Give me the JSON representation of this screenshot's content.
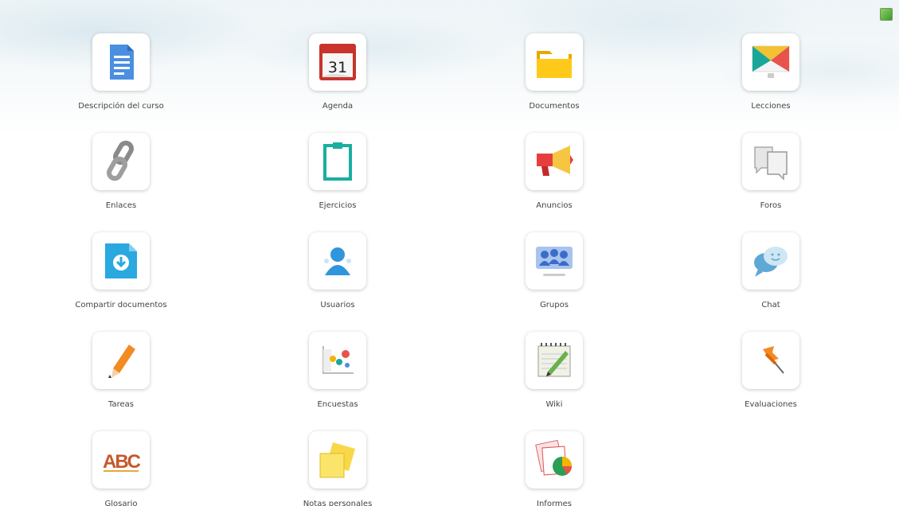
{
  "tools": [
    {
      "label": "Descripción del curso",
      "icon": "document-icon"
    },
    {
      "label": "Agenda",
      "icon": "calendar-icon",
      "day": "31"
    },
    {
      "label": "Documentos",
      "icon": "folder-icon"
    },
    {
      "label": "Lecciones",
      "icon": "monitor-icon"
    },
    {
      "label": "Enlaces",
      "icon": "chain-link-icon"
    },
    {
      "label": "Ejercicios",
      "icon": "clipboard-icon"
    },
    {
      "label": "Anuncios",
      "icon": "megaphone-icon"
    },
    {
      "label": "Foros",
      "icon": "speech-bubbles-icon"
    },
    {
      "label": "Compartir documentos",
      "icon": "download-document-icon"
    },
    {
      "label": "Usuarios",
      "icon": "user-icon"
    },
    {
      "label": "Grupos",
      "icon": "group-icon"
    },
    {
      "label": "Chat",
      "icon": "chat-bubbles-icon"
    },
    {
      "label": "Tareas",
      "icon": "pencil-icon"
    },
    {
      "label": "Encuestas",
      "icon": "survey-chart-icon"
    },
    {
      "label": "Wiki",
      "icon": "notepad-pencil-icon"
    },
    {
      "label": "Evaluaciones",
      "icon": "pushpin-icon"
    },
    {
      "label": "Glosario",
      "icon": "abc-icon",
      "abc_text": "ABC"
    },
    {
      "label": "Notas personales",
      "icon": "sticky-notes-icon"
    },
    {
      "label": "Informes",
      "icon": "reports-pie-icon"
    }
  ]
}
